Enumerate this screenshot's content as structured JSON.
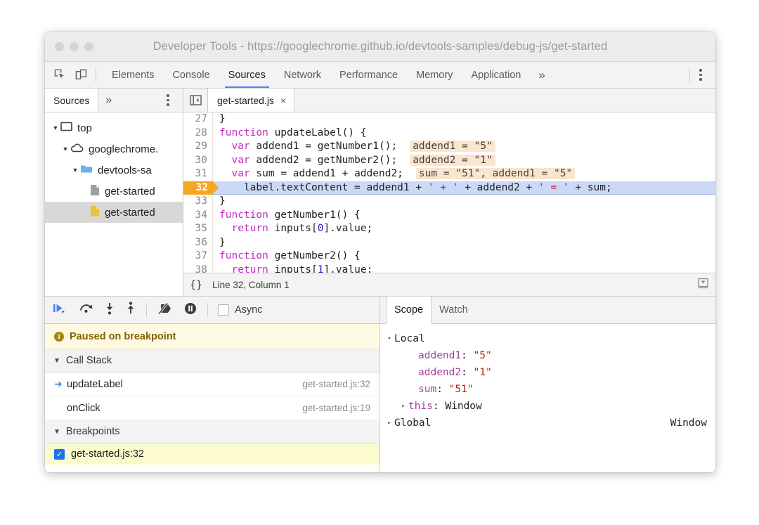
{
  "window": {
    "title": "Developer Tools - https://googlechrome.github.io/devtools-samples/debug-js/get-started"
  },
  "main_toolbar": {
    "icons": [
      {
        "name": "inspect-element-icon"
      },
      {
        "name": "device-toolbar-icon"
      }
    ],
    "tabs": [
      {
        "label": "Elements",
        "selected": false
      },
      {
        "label": "Console",
        "selected": false
      },
      {
        "label": "Sources",
        "selected": true
      },
      {
        "label": "Network",
        "selected": false
      },
      {
        "label": "Performance",
        "selected": false
      },
      {
        "label": "Memory",
        "selected": false
      },
      {
        "label": "Application",
        "selected": false
      }
    ],
    "more_tabs_label": "»",
    "kebab_label": "more-options"
  },
  "navigator": {
    "tabs": [
      {
        "label": "Sources",
        "selected": true
      }
    ],
    "more_label": "»",
    "tree": [
      {
        "label": "top",
        "icon": "frame-icon",
        "indent": 0,
        "expanded": true,
        "selected": false
      },
      {
        "label": "googlechrome.",
        "icon": "cloud-icon",
        "indent": 1,
        "expanded": true,
        "selected": false
      },
      {
        "label": "devtools-sa",
        "icon": "folder-icon",
        "indent": 2,
        "expanded": true,
        "selected": false
      },
      {
        "label": "get-started",
        "icon": "file-gray-icon",
        "indent": 3,
        "expanded": null,
        "selected": false
      },
      {
        "label": "get-started",
        "icon": "file-yellow-icon",
        "indent": 3,
        "expanded": null,
        "selected": true
      }
    ]
  },
  "editor": {
    "panel_toggle": "show-navigator-icon",
    "file_tab": {
      "label": "get-started.js",
      "close": "×"
    },
    "lines": [
      {
        "num": "27",
        "breakpoint": false,
        "tokens": [
          {
            "t": "}",
            "c": ""
          }
        ],
        "inline": null
      },
      {
        "num": "28",
        "breakpoint": false,
        "tokens": [
          {
            "t": "function",
            "c": "kw"
          },
          {
            "t": " updateLabel() {",
            "c": ""
          }
        ],
        "inline": null
      },
      {
        "num": "29",
        "breakpoint": false,
        "tokens": [
          {
            "t": "  ",
            "c": ""
          },
          {
            "t": "var",
            "c": "kw"
          },
          {
            "t": " addend1 = getNumber1();",
            "c": ""
          }
        ],
        "inline": "addend1 = \"5\""
      },
      {
        "num": "30",
        "breakpoint": false,
        "tokens": [
          {
            "t": "  ",
            "c": ""
          },
          {
            "t": "var",
            "c": "kw"
          },
          {
            "t": " addend2 = getNumber2();",
            "c": ""
          }
        ],
        "inline": "addend2 = \"1\""
      },
      {
        "num": "31",
        "breakpoint": false,
        "tokens": [
          {
            "t": "  ",
            "c": ""
          },
          {
            "t": "var",
            "c": "kw"
          },
          {
            "t": " sum = addend1 + addend2;",
            "c": ""
          }
        ],
        "inline": "sum = \"51\", addend1 = \"5\""
      },
      {
        "num": "32",
        "breakpoint": true,
        "tokens": [
          {
            "t": "    label.textContent = addend1 + ",
            "c": ""
          },
          {
            "t": "' + '",
            "c": "str"
          },
          {
            "t": " + addend2 + ",
            "c": ""
          },
          {
            "t": "' = '",
            "c": "str"
          },
          {
            "t": " + sum;",
            "c": ""
          }
        ],
        "inline": null
      },
      {
        "num": "33",
        "breakpoint": false,
        "tokens": [
          {
            "t": "}",
            "c": ""
          }
        ],
        "inline": null
      },
      {
        "num": "34",
        "breakpoint": false,
        "tokens": [
          {
            "t": "function",
            "c": "kw"
          },
          {
            "t": " getNumber1() {",
            "c": ""
          }
        ],
        "inline": null
      },
      {
        "num": "35",
        "breakpoint": false,
        "tokens": [
          {
            "t": "  ",
            "c": ""
          },
          {
            "t": "return",
            "c": "kw"
          },
          {
            "t": " inputs[",
            "c": ""
          },
          {
            "t": "0",
            "c": "num"
          },
          {
            "t": "].value;",
            "c": ""
          }
        ],
        "inline": null
      },
      {
        "num": "36",
        "breakpoint": false,
        "tokens": [
          {
            "t": "}",
            "c": ""
          }
        ],
        "inline": null
      },
      {
        "num": "37",
        "breakpoint": false,
        "tokens": [
          {
            "t": "function",
            "c": "kw"
          },
          {
            "t": " getNumber2() {",
            "c": ""
          }
        ],
        "inline": null
      },
      {
        "num": "38",
        "breakpoint": false,
        "tokens": [
          {
            "t": "  ",
            "c": ""
          },
          {
            "t": "return",
            "c": "kw"
          },
          {
            "t": " inputs[",
            "c": ""
          },
          {
            "t": "1",
            "c": "num"
          },
          {
            "t": "].value;",
            "c": ""
          }
        ],
        "inline": null
      }
    ],
    "status": {
      "format_icon": "{}",
      "position": "Line 32, Column 1",
      "scroll_icon": "jump-to-icon"
    }
  },
  "debugger_toolbar": {
    "buttons": [
      {
        "name": "resume-script-execution-button"
      },
      {
        "name": "step-over-button"
      },
      {
        "name": "step-into-button"
      },
      {
        "name": "step-out-button"
      },
      {
        "name": "deactivate-breakpoints-button"
      },
      {
        "name": "pause-on-exceptions-button"
      }
    ],
    "async_label": "Async",
    "async_checked": false
  },
  "paused_banner": {
    "icon": "info-icon",
    "text": "Paused on breakpoint"
  },
  "call_stack": {
    "header": "Call Stack",
    "expanded": true,
    "frames": [
      {
        "name": "updateLabel",
        "location": "get-started.js:32",
        "current": true
      },
      {
        "name": "onClick",
        "location": "get-started.js:19",
        "current": false
      }
    ]
  },
  "breakpoints": {
    "header": "Breakpoints",
    "expanded": true,
    "items": [
      {
        "label": "get-started.js:32",
        "checked": true
      }
    ]
  },
  "scope_panel": {
    "tabs": [
      {
        "label": "Scope",
        "selected": true
      },
      {
        "label": "Watch",
        "selected": false
      }
    ],
    "rows": [
      {
        "arrow": "▾",
        "indent": 0,
        "name": "Local",
        "sep": "",
        "value": "",
        "value_kind": "plain",
        "right": ""
      },
      {
        "arrow": "",
        "indent": 1,
        "name": "addend1",
        "sep": ": ",
        "value": "\"5\"",
        "value_kind": "string",
        "right": ""
      },
      {
        "arrow": "",
        "indent": 1,
        "name": "addend2",
        "sep": ": ",
        "value": "\"1\"",
        "value_kind": "string",
        "right": ""
      },
      {
        "arrow": "",
        "indent": 1,
        "name": "sum",
        "sep": ": ",
        "value": "\"51\"",
        "value_kind": "string",
        "right": ""
      },
      {
        "arrow": "▸",
        "indent": 1,
        "name": "this",
        "sep": ": ",
        "value": "Window",
        "value_kind": "plain",
        "right": ""
      },
      {
        "arrow": "▸",
        "indent": 0,
        "name": "Global",
        "sep": "",
        "value": "",
        "value_kind": "plain",
        "right": "Window"
      }
    ]
  },
  "colors": {
    "accent": "#4285f4",
    "breakpoint": "#f5a623",
    "paused_bg": "#fdf9e2",
    "keyword": "#c42ac4",
    "string": "#c41a16",
    "inline_value_bg": "#fbe5cd"
  }
}
